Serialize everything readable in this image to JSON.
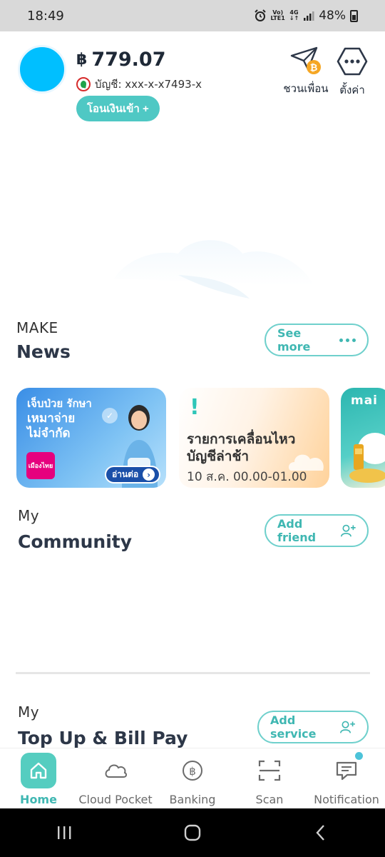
{
  "status_bar": {
    "time": "18:49",
    "network_top": "Vo)",
    "network_bottom": "LTE1",
    "network_type": "4G",
    "battery": "48%"
  },
  "header": {
    "currency_symbol": "฿",
    "balance": "779.07",
    "account_label": "บัญชี: xxx-x-x7493-x",
    "transfer_button": "โอนเงินเข้า +",
    "invite_label": "ชวนเพื่อน",
    "settings_label": "ตั้งค่า"
  },
  "news": {
    "kicker": "MAKE",
    "title": "News",
    "see_more": "See more",
    "cards": [
      {
        "line1": "เจ็บป่วย รักษา",
        "line2": "เหมาจ่าย",
        "line3": "ไม่จำกัด",
        "logo_text": "เมืองไทย",
        "read_more": "อ่านต่อ"
      },
      {
        "title": "รายการเคลื่อนไหว บัญชีล่าช้า",
        "subtitle": "10 ส.ค. 00.00-01.00"
      },
      {
        "logo": "mai"
      }
    ]
  },
  "community": {
    "kicker": "My",
    "title": "Community",
    "button": "Add friend"
  },
  "topup": {
    "kicker": "My",
    "title": "Top Up & Bill Pay",
    "button": "Add service"
  },
  "bottom_nav": {
    "items": [
      {
        "label": "Home",
        "icon": "home-icon"
      },
      {
        "label": "Cloud Pocket",
        "icon": "cloud-icon"
      },
      {
        "label": "Banking",
        "icon": "baht-icon"
      },
      {
        "label": "Scan",
        "icon": "scan-icon"
      },
      {
        "label": "Notification",
        "icon": "chat-icon"
      }
    ]
  },
  "colors": {
    "accent": "#4fc8c4",
    "avatar": "#00bfff",
    "text_dark": "#2d3748"
  }
}
